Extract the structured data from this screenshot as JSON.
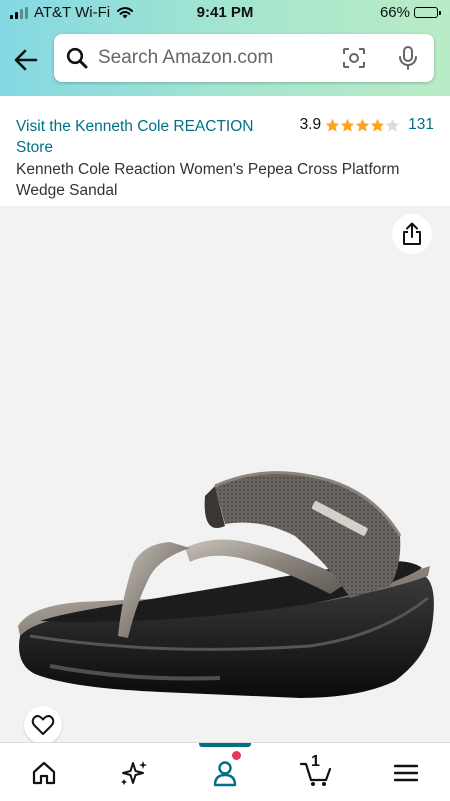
{
  "status_bar": {
    "carrier": "AT&T Wi-Fi",
    "time": "9:41 PM",
    "battery_percent": "66%",
    "battery_level": 0.66
  },
  "search": {
    "placeholder": "Search Amazon.com"
  },
  "product": {
    "store_link": "Visit the Kenneth Cole REACTION Store",
    "rating_value": "3.9",
    "rating_stars": 3.9,
    "rating_count": "131",
    "title": "Kenneth Cole Reaction Women's Pepea Cross Platform Wedge Sandal"
  },
  "icons": {
    "back": "back-arrow-icon",
    "search": "search-icon",
    "camera": "camera-scan-icon",
    "mic": "microphone-icon",
    "share": "share-icon",
    "favorite": "heart-icon",
    "nav": [
      "home-icon",
      "sparkle-icon",
      "account-icon",
      "cart-icon",
      "menu-icon"
    ]
  },
  "bottom_nav": {
    "cart_count": "1",
    "active_index": 2
  },
  "colors": {
    "link": "#007185",
    "star": "#ffa41c",
    "header_gradient_start": "#84d8e3",
    "header_gradient_end": "#b9ecc6",
    "notification_dot": "#e3385b"
  }
}
